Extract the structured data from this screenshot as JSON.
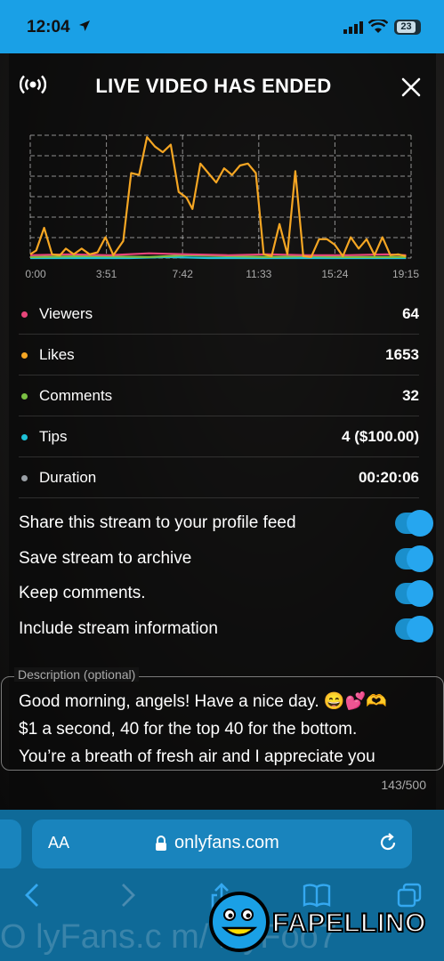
{
  "status_bar": {
    "time": "12:04",
    "battery": "23"
  },
  "header": {
    "title": "LIVE VIDEO HAS ENDED",
    "live_icon": "broadcast-icon",
    "close_icon": "close-icon"
  },
  "chart_data": {
    "type": "line",
    "x_ticks": [
      "0:00",
      "3:51",
      "7:42",
      "11:33",
      "15:24",
      "19:15"
    ],
    "x_range_minutes": [
      0,
      19.25
    ],
    "y_range": [
      0,
      130
    ],
    "grid": true,
    "series": [
      {
        "name": "Likes",
        "color": "#f5a623",
        "x": [
          0,
          0.3,
          0.7,
          1.1,
          1.5,
          1.8,
          2.2,
          2.6,
          3.0,
          3.4,
          3.8,
          4.2,
          4.7,
          5.1,
          5.5,
          5.9,
          6.3,
          6.7,
          7.1,
          7.5,
          7.9,
          8.2,
          8.6,
          9.0,
          9.4,
          9.8,
          10.2,
          10.6,
          11.0,
          11.4,
          11.8,
          12.2,
          12.6,
          13.0,
          13.4,
          13.8,
          14.2,
          14.6,
          15.0,
          15.4,
          15.8,
          16.2,
          16.6,
          17.0,
          17.4,
          17.8,
          18.2,
          18.6,
          19.0
        ],
        "y": [
          4,
          8,
          32,
          4,
          3,
          10,
          4,
          10,
          4,
          6,
          22,
          3,
          18,
          90,
          88,
          128,
          118,
          112,
          120,
          70,
          64,
          52,
          100,
          90,
          80,
          95,
          88,
          98,
          100,
          90,
          4,
          2,
          36,
          4,
          92,
          2,
          1,
          20,
          20,
          14,
          2,
          22,
          10,
          20,
          3,
          22,
          3,
          4,
          2
        ]
      },
      {
        "name": "Viewers",
        "color": "#e8457a",
        "x": [
          0,
          2,
          4,
          6,
          8,
          10,
          12,
          14,
          16,
          18,
          19
        ],
        "y": [
          3,
          4,
          3,
          5,
          4,
          3,
          4,
          3,
          3,
          4,
          3
        ]
      },
      {
        "name": "Comments",
        "color": "#7bc043",
        "x": [
          0,
          3,
          6,
          8,
          10,
          12,
          14,
          16,
          18,
          19
        ],
        "y": [
          1,
          2,
          1,
          3,
          2,
          1,
          2,
          1,
          1,
          1
        ]
      },
      {
        "name": "Tips",
        "color": "#1ec2d8",
        "x": [
          0,
          5,
          7,
          9,
          12,
          15,
          19
        ],
        "y": [
          0,
          0,
          1,
          0,
          0,
          0,
          0
        ]
      }
    ]
  },
  "stats": [
    {
      "label": "Viewers",
      "value": "64",
      "color": "#e8457a"
    },
    {
      "label": "Likes",
      "value": "1653",
      "color": "#f5a623"
    },
    {
      "label": "Comments",
      "value": "32",
      "color": "#7bc043"
    },
    {
      "label": "Tips",
      "value": "4 ($100.00)",
      "color": "#1ec2d8"
    },
    {
      "label": "Duration",
      "value": "00:20:06",
      "color": "#9aa0a6"
    }
  ],
  "toggles": [
    {
      "label": "Share this stream to your profile feed",
      "on": true
    },
    {
      "label": "Save stream to archive",
      "on": true
    },
    {
      "label": "Keep comments.",
      "on": true
    },
    {
      "label": "Include stream information",
      "on": true
    }
  ],
  "description": {
    "legend": "Description (optional)",
    "text_line1": "Good morning, angels!  Have a nice day. 😄💕🫶",
    "text_line2": "$1 a second, 40 for the top 40 for the bottom.",
    "text_line3": "You’re a breath of fresh air and I appreciate you",
    "counter": "143/500"
  },
  "browser": {
    "aa": "AA",
    "url": "onlyfans.com"
  },
  "watermark": {
    "text": "O lyFans.c m/ L'yFoo7",
    "logo_text": "FAPELLINO"
  }
}
